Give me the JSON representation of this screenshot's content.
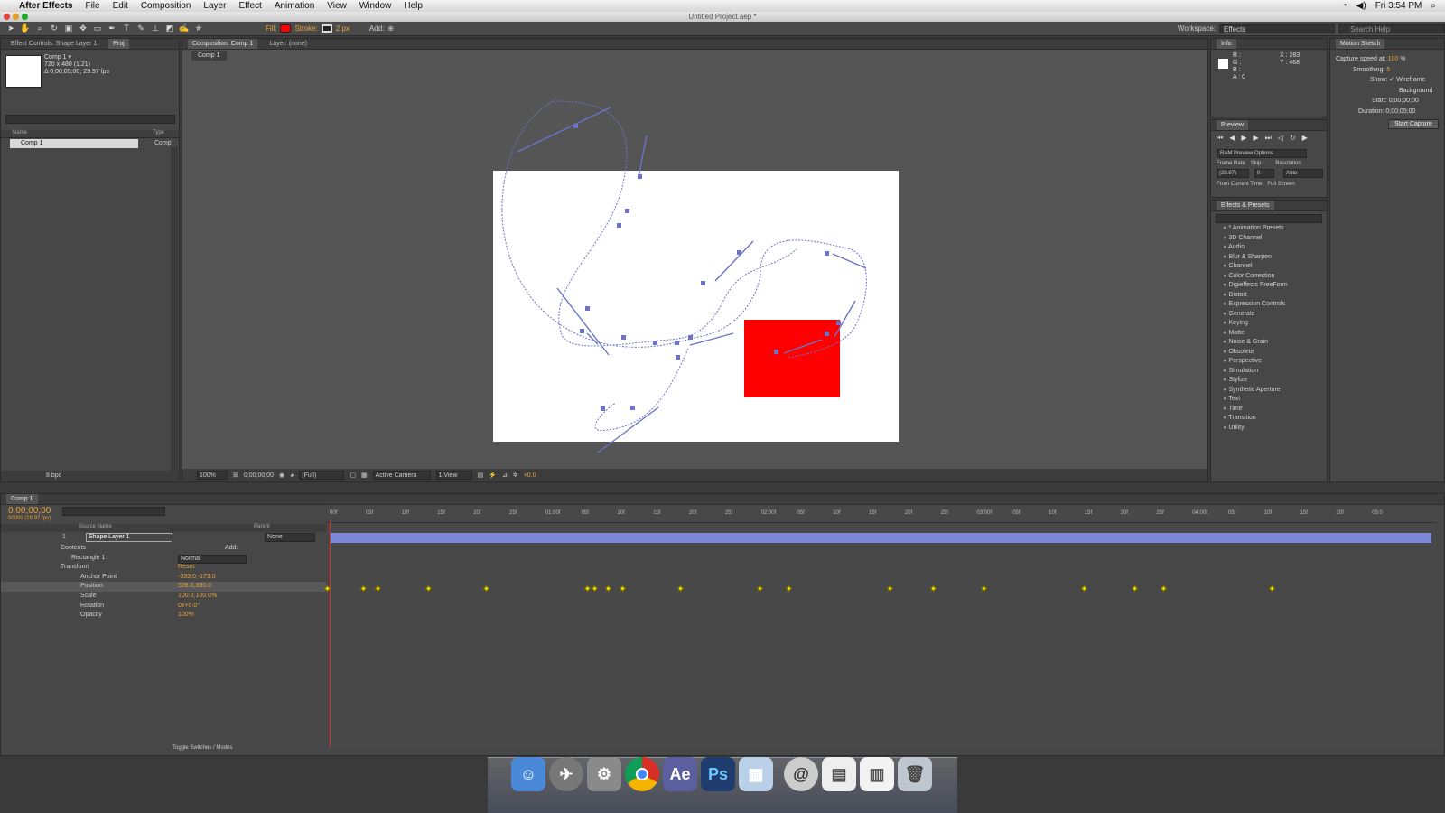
{
  "menubar": {
    "app": "After Effects",
    "items": [
      "File",
      "Edit",
      "Composition",
      "Layer",
      "Effect",
      "Animation",
      "View",
      "Window",
      "Help"
    ],
    "clock": "Fri 3:54 PM"
  },
  "window_title": "Untitled Project.aep *",
  "toolbar": {
    "fill_label": "Fill:",
    "stroke_label": "Stroke:",
    "stroke_width": "2 px",
    "add_label": "Add:",
    "workspace_label": "Workspace:",
    "workspace_value": "Effects",
    "search_help_placeholder": "Search Help"
  },
  "project_panel": {
    "tab_effect_controls": "Effect Controls: Shape Layer 1",
    "tab_project": "Proj",
    "item_name": "Comp 1 ▾",
    "item_dims": "720 x 480 (1.21)",
    "item_duration": "Δ 0;00;05;00, 29.97 fps",
    "col_name": "Name",
    "col_type": "Type",
    "row_name": "Comp 1",
    "row_type": "Comp",
    "bpc": "8 bpc"
  },
  "comp_panel": {
    "tab_composition": "Composition: Comp 1",
    "tab_layer": "Layer: (none)",
    "comp_tab": "Comp 1",
    "zoom": "100%",
    "timecode": "0;00;00;00",
    "resolution": "(Full)",
    "camera": "Active Camera",
    "views": "1 View",
    "exposure": "+0.0"
  },
  "info_panel": {
    "tab": "Info",
    "r": "R :",
    "g": "G :",
    "b": "B :",
    "a": "A : 0",
    "x": "X : 283",
    "y": "Y : 468"
  },
  "preview_panel": {
    "tab": "Preview",
    "options": "RAM Preview Options",
    "frame_rate_label": "Frame Rate",
    "skip_label": "Skip",
    "resolution_label": "Resolution",
    "frame_rate": "(29.97)",
    "skip": "0",
    "resolution": "Auto",
    "from_current": "From Current Time",
    "full_screen": "Full Screen"
  },
  "effects_panel": {
    "tab": "Effects & Presets",
    "items": [
      "* Animation Presets",
      "3D Channel",
      "Audio",
      "Blur & Sharpen",
      "Channel",
      "Color Correction",
      "Digieffects FreeForm",
      "Distort",
      "Expression Controls",
      "Generate",
      "Keying",
      "Matte",
      "Noise & Grain",
      "Obsolete",
      "Perspective",
      "Simulation",
      "Stylize",
      "Synthetic Aperture",
      "Text",
      "Time",
      "Transition",
      "Utility"
    ]
  },
  "motion_sketch": {
    "tab": "Motion Sketch",
    "capture_label": "Capture speed at:",
    "capture_value": "100",
    "capture_unit": "%",
    "smoothing_label": "Smoothing:",
    "smoothing_value": "5",
    "show_label": "Show:",
    "wireframe": "Wireframe",
    "background": "Background",
    "start_label": "Start:",
    "start_value": "0;00;00;00",
    "duration_label": "Duration:",
    "duration_value": "0;00;05;00",
    "button": "Start Capture"
  },
  "timeline": {
    "tab": "Comp 1",
    "timecode": "0;00;00;00",
    "frames": "00000 (29.97 fps)",
    "col_source": "Source Name",
    "col_parent": "Parent",
    "layer_num": "1",
    "layer_name": "Shape Layer 1",
    "parent_value": "None",
    "contents": "Contents",
    "add_label": "Add:",
    "rectangle": "Rectangle 1",
    "blend_mode": "Normal",
    "transform": "Transform",
    "reset": "Reset",
    "anchor_label": "Anchor Point",
    "anchor_value": "-333.0,-173.0",
    "position_label": "Position",
    "position_value": "528.0,330.0",
    "scale_label": "Scale",
    "scale_value": "100.0,100.0%",
    "rotation_label": "Rotation",
    "rotation_value": "0x+0.0°",
    "opacity_label": "Opacity",
    "opacity_value": "100%",
    "toggle": "Toggle Switches / Modes",
    "ruler": [
      "00f",
      "05f",
      "10f",
      "15f",
      "20f",
      "25f",
      "01:00f",
      "05f",
      "10f",
      "15f",
      "20f",
      "25f",
      "02:00f",
      "05f",
      "10f",
      "15f",
      "20f",
      "25f",
      "03:00f",
      "05f",
      "10f",
      "15f",
      "20f",
      "25f",
      "04:00f",
      "05f",
      "10f",
      "15f",
      "20f",
      "05:0"
    ]
  },
  "dock": {
    "ae_label": "Ae",
    "ps_label": "Ps"
  }
}
